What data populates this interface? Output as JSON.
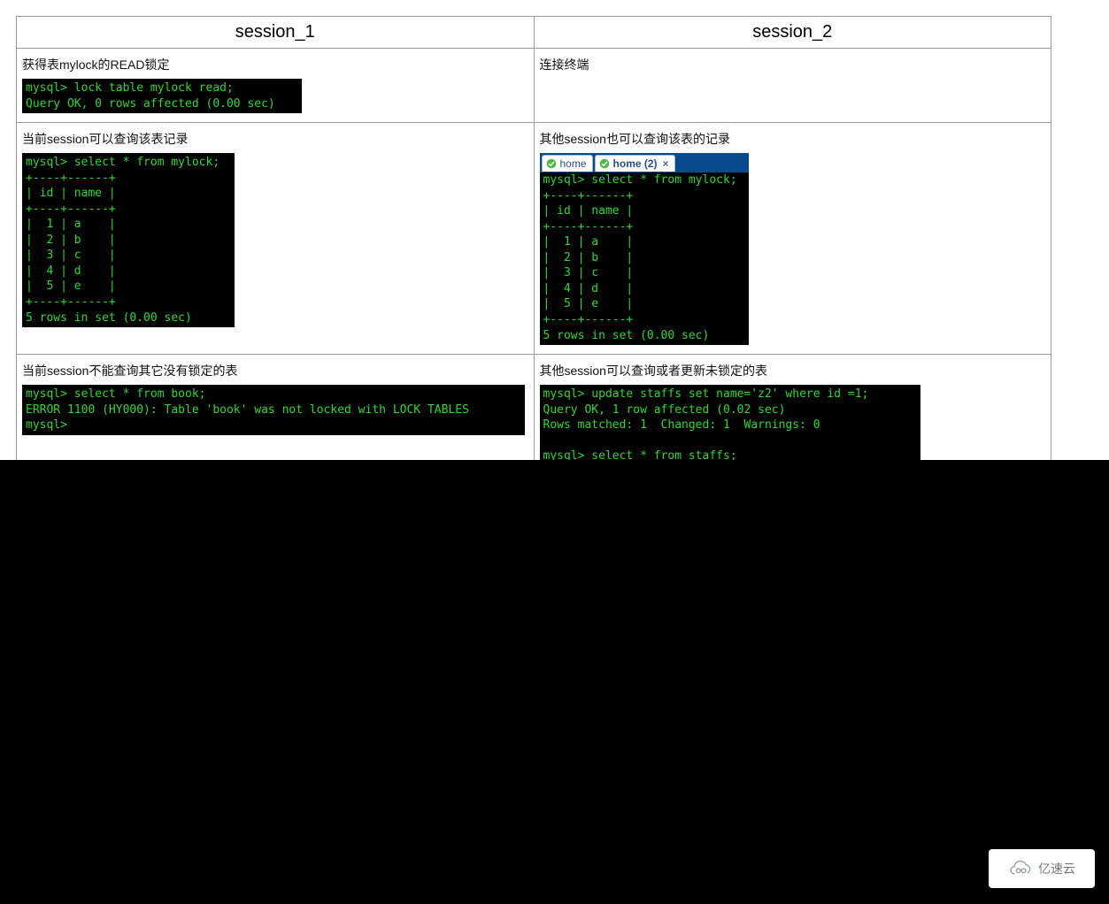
{
  "headers": {
    "col1": "session_1",
    "col2": "session_2"
  },
  "rows": [
    {
      "left": {
        "desc": "获得表mylock的READ锁定",
        "term": "mysql> lock table mylock read;\nQuery OK, 0 rows affected (0.00 sec)"
      },
      "right": {
        "desc": "连接终端",
        "term": ""
      }
    },
    {
      "left": {
        "desc": "当前session可以查询该表记录",
        "term": "mysql> select * from mylock;\n+----+------+\n| id | name |\n+----+------+\n|  1 | a    |\n|  2 | b    |\n|  3 | c    |\n|  4 | d    |\n|  5 | e    |\n+----+------+\n5 rows in set (0.00 sec)"
      },
      "right": {
        "desc": "其他session也可以查询该表的记录",
        "tabs": {
          "t1": "home",
          "t2": "home (2)",
          "close": "×"
        },
        "term": "mysql> select * from mylock;\n+----+------+\n| id | name |\n+----+------+\n|  1 | a    |\n|  2 | b    |\n|  3 | c    |\n|  4 | d    |\n|  5 | e    |\n+----+------+\n5 rows in set (0.00 sec)"
      }
    },
    {
      "left": {
        "desc": "当前session不能查询其它没有锁定的表",
        "term": "mysql> select * from book;\nERROR 1100 (HY000): Table 'book' was not locked with LOCK TABLES\nmysql>"
      },
      "right": {
        "desc": "其他session可以查询或者更新未锁定的表",
        "term": "mysql> update staffs set name='z2' where id =1;\nQuery OK, 1 row affected (0.02 sec)\nRows matched: 1  Changed: 1  Warnings: 0\n\nmysql> select * from staffs;\n+----+------+-----+---------+---------------------+\n| id | NAME | age | pos     | add_time            |\n+----+------+-----+---------+---------------------+"
      }
    }
  ],
  "watermark": "亿速云"
}
